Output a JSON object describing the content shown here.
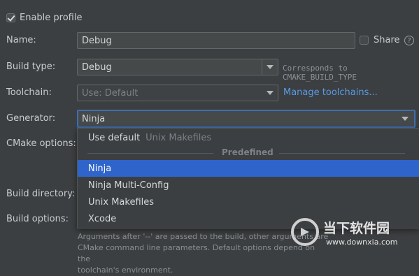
{
  "enable_profile": {
    "label": "Enable profile",
    "checked": true
  },
  "name": {
    "label": "Name:",
    "value": "Debug"
  },
  "share": {
    "label": "Share",
    "checked": false,
    "help_glyph": "?"
  },
  "build_type": {
    "label": "Build type:",
    "value": "Debug",
    "hint": "Corresponds to CMAKE_BUILD_TYPE"
  },
  "toolchain": {
    "label": "Toolchain:",
    "value": "Use: Default",
    "link": "Manage toolchains..."
  },
  "generator": {
    "label": "Generator:",
    "value": "Ninja",
    "dropdown": {
      "default_label": "Use default",
      "default_value": "Unix Makefiles",
      "section": "Predefined",
      "options": [
        "Ninja",
        "Ninja Multi-Config",
        "Unix Makefiles",
        "Xcode"
      ],
      "selected": "Ninja"
    }
  },
  "cmake_options": {
    "label": "CMake options:"
  },
  "build_directory": {
    "label": "Build directory:"
  },
  "build_options": {
    "label": "Build options:",
    "help_lines": [
      "Arguments after '--' are passed to the build, other arguments are",
      "CMake command line parameters. Default options depend on the",
      "toolchain's environment."
    ]
  },
  "watermark": {
    "brand": "当下软件园",
    "url": "www.downxia.com"
  }
}
